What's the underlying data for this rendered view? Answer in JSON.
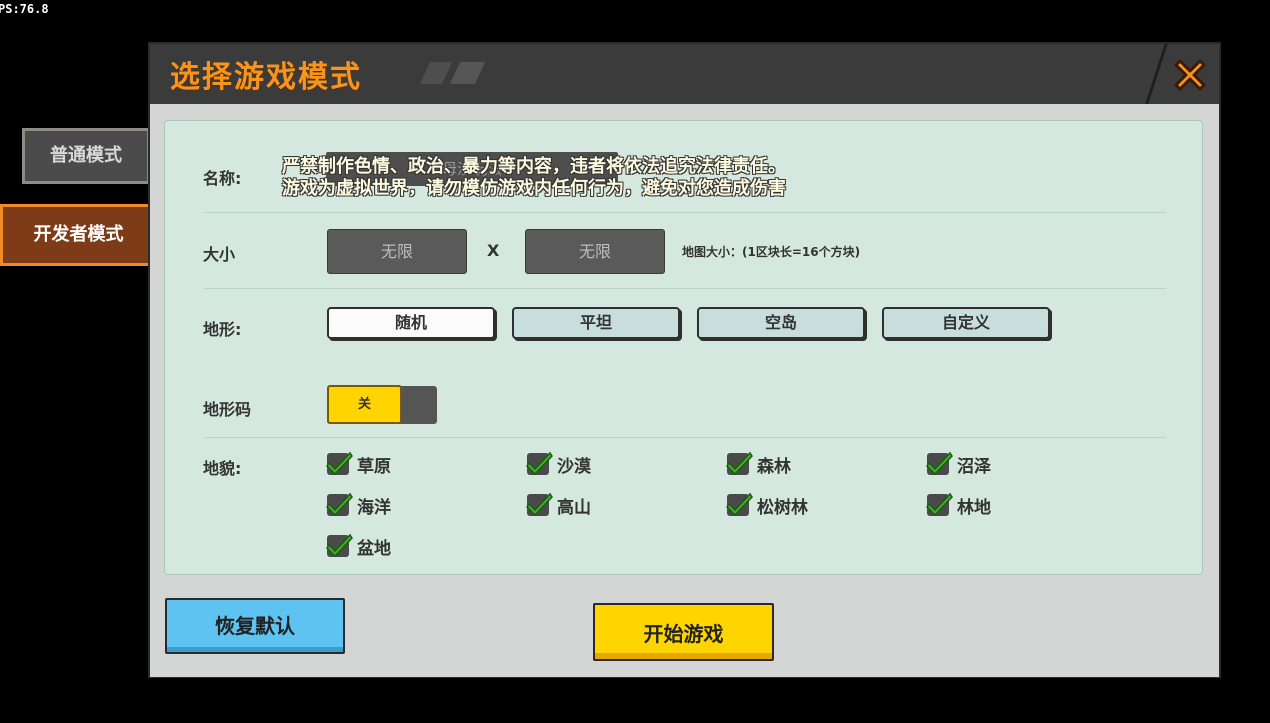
{
  "fps": "PS:76.8",
  "window": {
    "title": "选择游戏模式"
  },
  "side_tabs": {
    "normal": "普通模式",
    "developer": "开发者模式"
  },
  "form": {
    "name_label": "名称:",
    "name_value": "母沙玩法",
    "notice_line1": "严禁制作色情、政治、暴力等内容，违者将依法追究法律责任。",
    "notice_line2": "游戏为虚拟世界，请勿模仿游戏内任何行为，避免对您造成伤害",
    "size_label": "大小",
    "size_width": "无限",
    "size_x": "X",
    "size_height": "无限",
    "size_hint": "地图大小：(1区块长=16个方块)",
    "terrain_label": "地形:",
    "terrain_options": [
      "随机",
      "平坦",
      "空岛",
      "自定义"
    ],
    "terrain_selected": "随机",
    "terrain_code_label": "地形码",
    "terrain_code_toggle": "关",
    "biome_label": "地貌:",
    "biomes": [
      "草原",
      "沙漠",
      "森林",
      "沼泽",
      "海洋",
      "高山",
      "松树林",
      "林地",
      "盆地"
    ]
  },
  "buttons": {
    "reset": "恢复默认",
    "start": "开始游戏"
  },
  "colors": {
    "title_orange": "#f7941d",
    "dev_tab_border": "#f28a26",
    "start_yellow": "#ffd500",
    "reset_blue": "#5ec3f0",
    "check_green": "#3fb02a"
  }
}
